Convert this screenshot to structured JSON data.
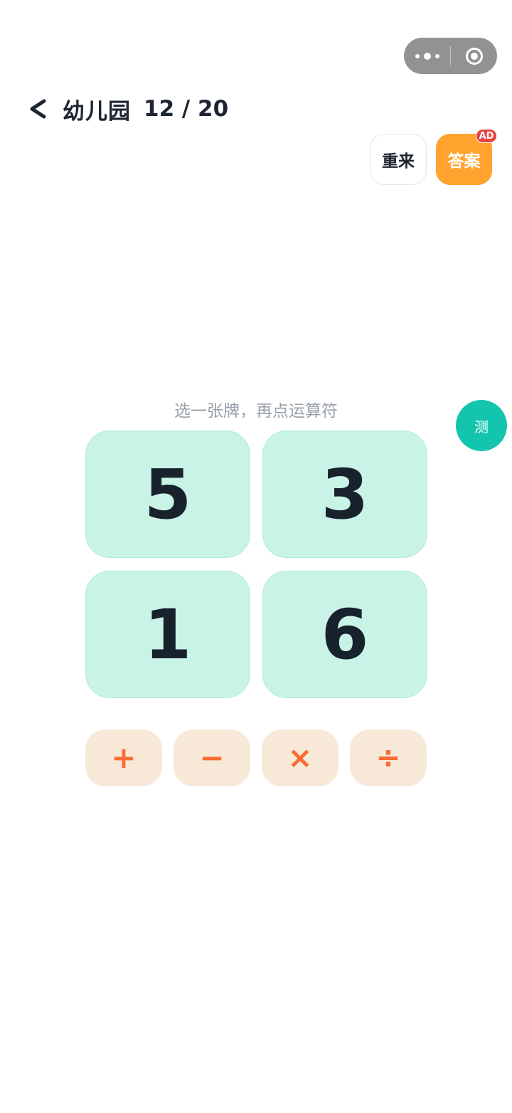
{
  "capsule": {
    "more_icon": "more-dots-icon",
    "close_icon": "target-circle-icon"
  },
  "header": {
    "back_icon": "chevron-left-icon",
    "level_name": "幼儿园",
    "progress": "12 / 20"
  },
  "actions": {
    "restart_label": "重来",
    "answer_label": "答案",
    "ad_badge": "AD",
    "answer_color": "#ffa32e",
    "ad_color": "#e74343"
  },
  "hint": "选一张牌，再点运算符",
  "test_button": {
    "label": "测",
    "color": "#13c5ad"
  },
  "cards": [
    "5",
    "3",
    "1",
    "6"
  ],
  "card_color": "#c8f3e6",
  "operators": [
    {
      "symbol": "+",
      "name": "plus"
    },
    {
      "symbol": "−",
      "name": "minus"
    },
    {
      "symbol": "×",
      "name": "multiply"
    },
    {
      "symbol": "÷",
      "name": "divide"
    }
  ],
  "operator_color": "#fa6c33"
}
